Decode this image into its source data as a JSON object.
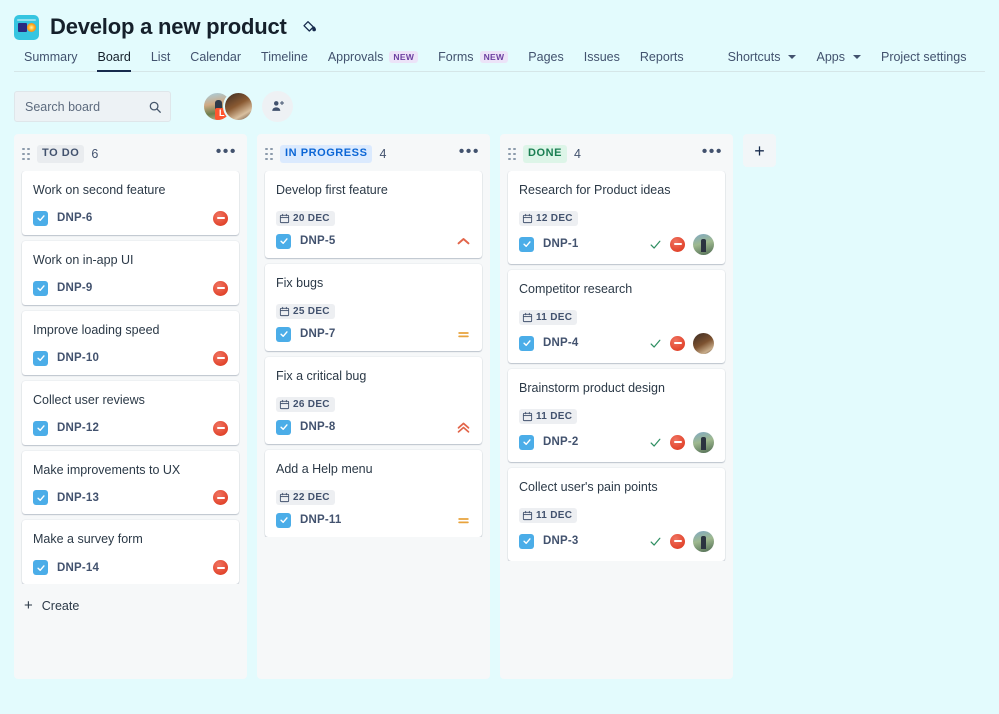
{
  "header": {
    "project_icon": "project-avatar-icon",
    "title": "Develop a new product",
    "edit_icon": "paint-bucket-icon"
  },
  "nav": {
    "items": [
      {
        "label": "Summary",
        "active": false,
        "badge": null,
        "caret": false
      },
      {
        "label": "Board",
        "active": true,
        "badge": null,
        "caret": false
      },
      {
        "label": "List",
        "active": false,
        "badge": null,
        "caret": false
      },
      {
        "label": "Calendar",
        "active": false,
        "badge": null,
        "caret": false
      },
      {
        "label": "Timeline",
        "active": false,
        "badge": null,
        "caret": false
      },
      {
        "label": "Approvals",
        "active": false,
        "badge": "NEW",
        "caret": false
      },
      {
        "label": "Forms",
        "active": false,
        "badge": "NEW",
        "caret": false
      },
      {
        "label": "Pages",
        "active": false,
        "badge": null,
        "caret": false
      },
      {
        "label": "Issues",
        "active": false,
        "badge": null,
        "caret": false
      },
      {
        "label": "Reports",
        "active": false,
        "badge": null,
        "caret": false
      },
      {
        "label": "Shortcuts",
        "active": false,
        "badge": null,
        "caret": true
      },
      {
        "label": "Apps",
        "active": false,
        "badge": null,
        "caret": true
      },
      {
        "label": "Project settings",
        "active": false,
        "badge": null,
        "caret": false
      }
    ]
  },
  "toolbar": {
    "search_placeholder": "Search board",
    "search_value": "",
    "search_icon": "search-icon",
    "avatar_badge_label": "L",
    "add_person_icon": "add-person-icon"
  },
  "colors": {
    "page_background": "#e3fbfd",
    "column_background": "#f6f8f9",
    "card_background": "#ffffff",
    "accent_blue": "#0b66d6",
    "done_green": "#1a7f52",
    "blocker_red": "#e2452d",
    "medium_orange": "#e8a33d",
    "task_blue": "#4bade8",
    "new_badge_purple": "#6b3fa0"
  },
  "board": {
    "add_column_label": "+",
    "columns": [
      {
        "name": "TO DO",
        "style": "todo",
        "count": "6",
        "more_icon": "more-options-icon",
        "create_label": "Create",
        "show_create": true,
        "cards": [
          {
            "title": "Work on second feature",
            "due": null,
            "key": "DNP-6",
            "priority": "blocker",
            "done": false,
            "avatar": null
          },
          {
            "title": "Work on in-app UI",
            "due": null,
            "key": "DNP-9",
            "priority": "blocker",
            "done": false,
            "avatar": null
          },
          {
            "title": "Improve loading speed",
            "due": null,
            "key": "DNP-10",
            "priority": "blocker",
            "done": false,
            "avatar": null
          },
          {
            "title": "Collect user reviews",
            "due": null,
            "key": "DNP-12",
            "priority": "blocker",
            "done": false,
            "avatar": null
          },
          {
            "title": "Make improvements to UX",
            "due": null,
            "key": "DNP-13",
            "priority": "blocker",
            "done": false,
            "avatar": null
          },
          {
            "title": "Make a survey form",
            "due": null,
            "key": "DNP-14",
            "priority": "blocker",
            "done": false,
            "avatar": null
          }
        ]
      },
      {
        "name": "IN PROGRESS",
        "style": "prog",
        "count": "4",
        "more_icon": "more-options-icon",
        "create_label": "Create",
        "show_create": false,
        "cards": [
          {
            "title": "Develop first feature",
            "due": "20 DEC",
            "key": "DNP-5",
            "priority": "high",
            "done": false,
            "avatar": null
          },
          {
            "title": "Fix bugs",
            "due": "25 DEC",
            "key": "DNP-7",
            "priority": "medium",
            "done": false,
            "avatar": null
          },
          {
            "title": "Fix a critical bug",
            "due": "26 DEC",
            "key": "DNP-8",
            "priority": "highest",
            "done": false,
            "avatar": null
          },
          {
            "title": "Add a Help menu",
            "due": "22 DEC",
            "key": "DNP-11",
            "priority": "medium",
            "done": false,
            "avatar": null
          }
        ]
      },
      {
        "name": "DONE",
        "style": "done",
        "count": "4",
        "more_icon": "more-options-icon",
        "create_label": "Create",
        "show_create": false,
        "cards": [
          {
            "title": "Research for Product ideas",
            "due": "12 DEC",
            "key": "DNP-1",
            "priority": "blocker",
            "done": true,
            "avatar": "cav-1"
          },
          {
            "title": "Competitor research",
            "due": "11 DEC",
            "key": "DNP-4",
            "priority": "blocker",
            "done": true,
            "avatar": "cav-2"
          },
          {
            "title": "Brainstorm product design",
            "due": "11 DEC",
            "key": "DNP-2",
            "priority": "blocker",
            "done": true,
            "avatar": "cav-1"
          },
          {
            "title": "Collect user's pain points",
            "due": "11 DEC",
            "key": "DNP-3",
            "priority": "blocker",
            "done": true,
            "avatar": "cav-1"
          }
        ]
      }
    ]
  }
}
